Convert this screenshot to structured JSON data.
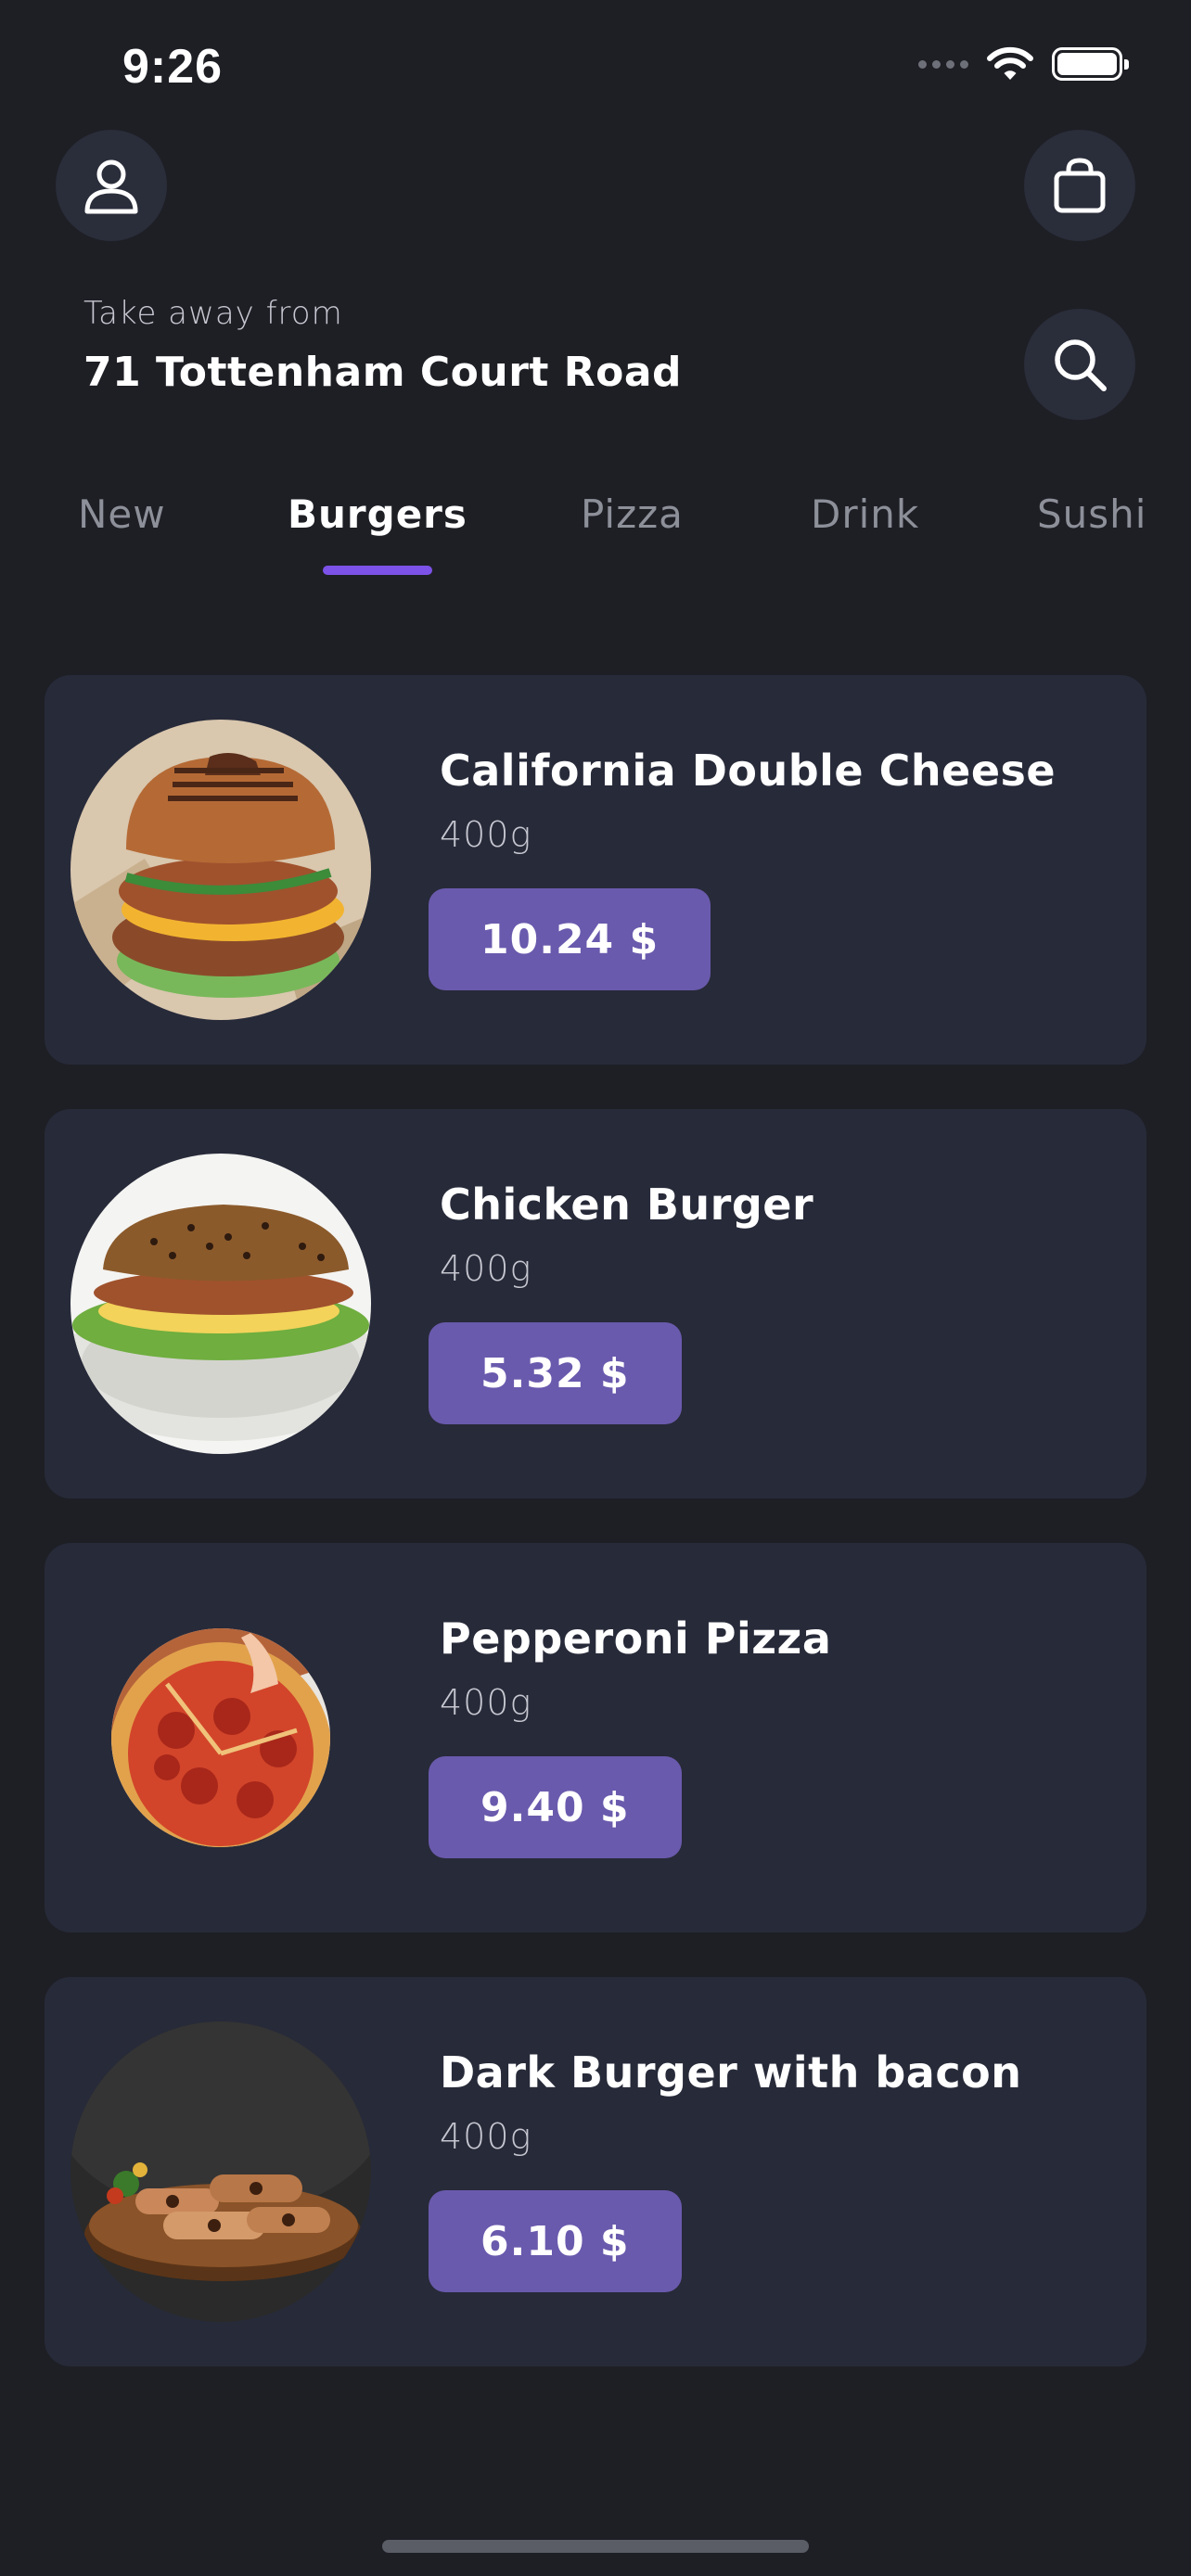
{
  "status_bar": {
    "time": "9:26",
    "icons": [
      "signal-icon",
      "wifi-icon",
      "battery-icon"
    ]
  },
  "header": {
    "profile_icon": "user-icon",
    "bag_icon": "shopping-bag-icon",
    "search_icon": "search-icon"
  },
  "location": {
    "caption": "Take away from",
    "address": "71 Tottenham Court Road"
  },
  "tabs": [
    {
      "label": "New"
    },
    {
      "label": "Burgers",
      "active": true
    },
    {
      "label": "Pizza"
    },
    {
      "label": "Drink"
    },
    {
      "label": "Sushi"
    }
  ],
  "products": [
    {
      "name": "California Double Cheese",
      "weight": "400g",
      "price": "10.24 $",
      "image": "burger-photo"
    },
    {
      "name": "Chicken Burger",
      "weight": "400g",
      "price": "5.32 $",
      "image": "chicken-sandwich-photo"
    },
    {
      "name": "Pepperoni Pizza",
      "weight": "400g",
      "price": "9.40 $",
      "image": "pepperoni-pizza-photo"
    },
    {
      "name": "Dark Burger with bacon",
      "weight": "400g",
      "price": "6.10 $",
      "image": "dark-burger-photo"
    }
  ],
  "colors": {
    "background": "#1e1f25",
    "card": "#272a39",
    "accent": "#7c52e8",
    "price_button": "#6a5aad",
    "muted_text": "#8d8f99"
  }
}
